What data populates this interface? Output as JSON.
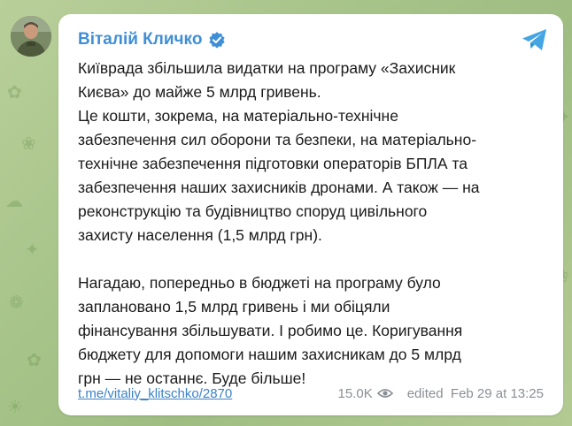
{
  "channel": {
    "name": "Віталій Кличко",
    "verified": true,
    "accent_color": "#3f8fd6"
  },
  "icons": {
    "verified": "verified-badge-icon",
    "share": "telegram-share-icon",
    "views": "eye-icon"
  },
  "message": {
    "lines_p1": [
      "Київрада збільшила видатки на програму «Захисник",
      "Києва» до майже 5 млрд гривень.",
      "Це кошти, зокрема, на матеріально-технічне",
      "забезпечення сил оборони та безпеки, на матеріально-",
      "технічне забезпечення підготовки операторів БПЛА та",
      "забезпечення наших захисників дронами. А також — на",
      "реконструкцію та будівництво споруд цивільного",
      "захисту населення (1,5 млрд грн)."
    ],
    "lines_p2": [
      "Нагадаю, попередньо в бюджеті на програму було",
      "заплановано 1,5 млрд гривень і ми обіцяли",
      "фінансування збільшувати. І робимо це. Коригування",
      "бюджету для допомоги нашим захисникам до 5 млрд",
      "грн — не останнє. Буде більше!"
    ]
  },
  "footer": {
    "link": "t.me/vitaliy_klitschko/2870",
    "views": "15.0K",
    "edited_timestamp": "edited  Feb 29 at 13:25"
  }
}
